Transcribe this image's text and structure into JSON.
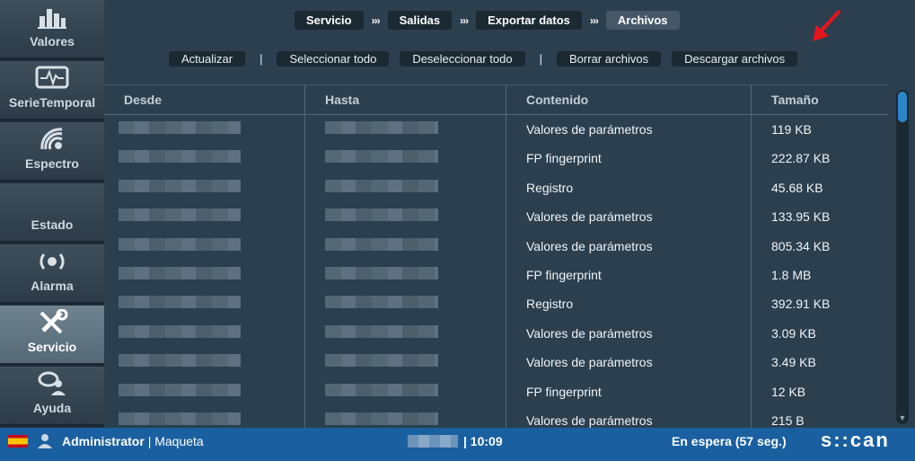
{
  "sidebar": {
    "items": [
      {
        "label": "Valores",
        "icon": "bar-chart-icon"
      },
      {
        "label": "SerieTemporal",
        "icon": "waveform-icon"
      },
      {
        "label": "Espectro",
        "icon": "spectrum-icon"
      },
      {
        "label": "Estado",
        "icon": ""
      },
      {
        "label": "Alarma",
        "icon": "alarm-icon"
      },
      {
        "label": "Servicio",
        "icon": "tools-icon",
        "active": true
      },
      {
        "label": "Ayuda",
        "icon": "help-icon"
      }
    ]
  },
  "breadcrumb": {
    "items": [
      "Servicio",
      "Salidas",
      "Exportar datos",
      "Archivos"
    ],
    "separator": "›››"
  },
  "actions": {
    "refresh": "Actualizar",
    "select_all": "Seleccionar todo",
    "deselect_all": "Deseleccionar todo",
    "delete_files": "Borrar archivos",
    "download_files": "Descargar archivos",
    "pipe": "|"
  },
  "table": {
    "headers": [
      "Desde",
      "Hasta",
      "Contenido",
      "Tamaño"
    ],
    "rows": [
      {
        "contenido": "Valores de parámetros",
        "tamano": "119 KB"
      },
      {
        "contenido": "FP fingerprint",
        "tamano": "222.87 KB"
      },
      {
        "contenido": "Registro",
        "tamano": "45.68 KB"
      },
      {
        "contenido": "Valores de parámetros",
        "tamano": "133.95 KB"
      },
      {
        "contenido": "Valores de parámetros",
        "tamano": "805.34 KB"
      },
      {
        "contenido": "FP fingerprint",
        "tamano": "1.8 MB"
      },
      {
        "contenido": "Registro",
        "tamano": "392.91 KB"
      },
      {
        "contenido": "Valores de parámetros",
        "tamano": "3.09 KB"
      },
      {
        "contenido": "Valores de parámetros",
        "tamano": "3.49 KB"
      },
      {
        "contenido": "FP fingerprint",
        "tamano": "12 KB"
      },
      {
        "contenido": "Valores de parámetros",
        "tamano": "215 B"
      }
    ]
  },
  "status": {
    "user_role": "Administrator",
    "mode": "| Maqueta",
    "time": "| 10:09",
    "state": "En espera (57 seg.)",
    "logo": "s::can"
  },
  "colors": {
    "accent": "#1a5fa0",
    "arrow": "#e8141c",
    "scroll_thumb": "#2a86c8"
  }
}
